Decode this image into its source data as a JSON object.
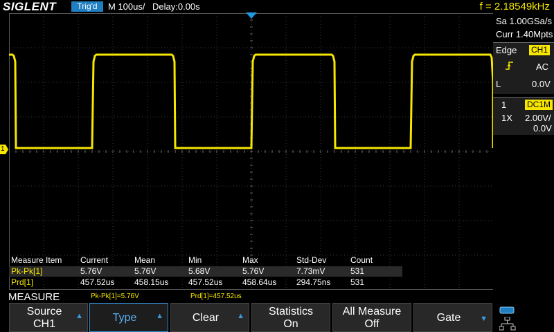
{
  "header": {
    "brand": "SIGLENT",
    "trig_status": "Trig'd",
    "timebase": "M 100us/",
    "delay": "Delay:0.00s",
    "frequency": "f = 2.18549kHz"
  },
  "acquisition": {
    "sample_rate": "Sa 1.00GSa/s",
    "memory": "Curr 1.40Mpts"
  },
  "trigger": {
    "type_label": "Edge",
    "source": "CH1",
    "coupling": "AC",
    "level_label": "L",
    "level": "0.0V"
  },
  "channel": {
    "number": "1",
    "coupling": "DC1M",
    "probe": "1X",
    "scale": "2.00V/",
    "offset": "0.0V"
  },
  "waveform": {
    "marker": "1",
    "color": "#f6e600",
    "trace_color": "#f6e600"
  },
  "measure_table": {
    "headers": [
      "Measure Item",
      "Current",
      "Mean",
      "Min",
      "Max",
      "Std-Dev",
      "Count"
    ],
    "rows": [
      [
        "Pk-Pk[1]",
        "5.76V",
        "5.76V",
        "5.68V",
        "5.76V",
        "7.73mV",
        "531"
      ],
      [
        "Prd[1]",
        "457.52us",
        "458.15us",
        "457.52us",
        "458.64us",
        "294.75ns",
        "531"
      ]
    ]
  },
  "measure_bar": {
    "title": "MEASURE",
    "result1": "Pk-Pk[1]=5.76V",
    "result2": "Prd[1]=457.52us"
  },
  "softkeys": {
    "source_line1": "Source",
    "source_line2": "CH1",
    "type": "Type",
    "clear": "Clear",
    "statistics_line1": "Statistics",
    "statistics_line2": "On",
    "all_measure_line1": "All Measure",
    "all_measure_line2": "Off",
    "gate": "Gate"
  },
  "colors": {
    "accent": "#1f7fc2",
    "channel1": "#f6e600"
  }
}
